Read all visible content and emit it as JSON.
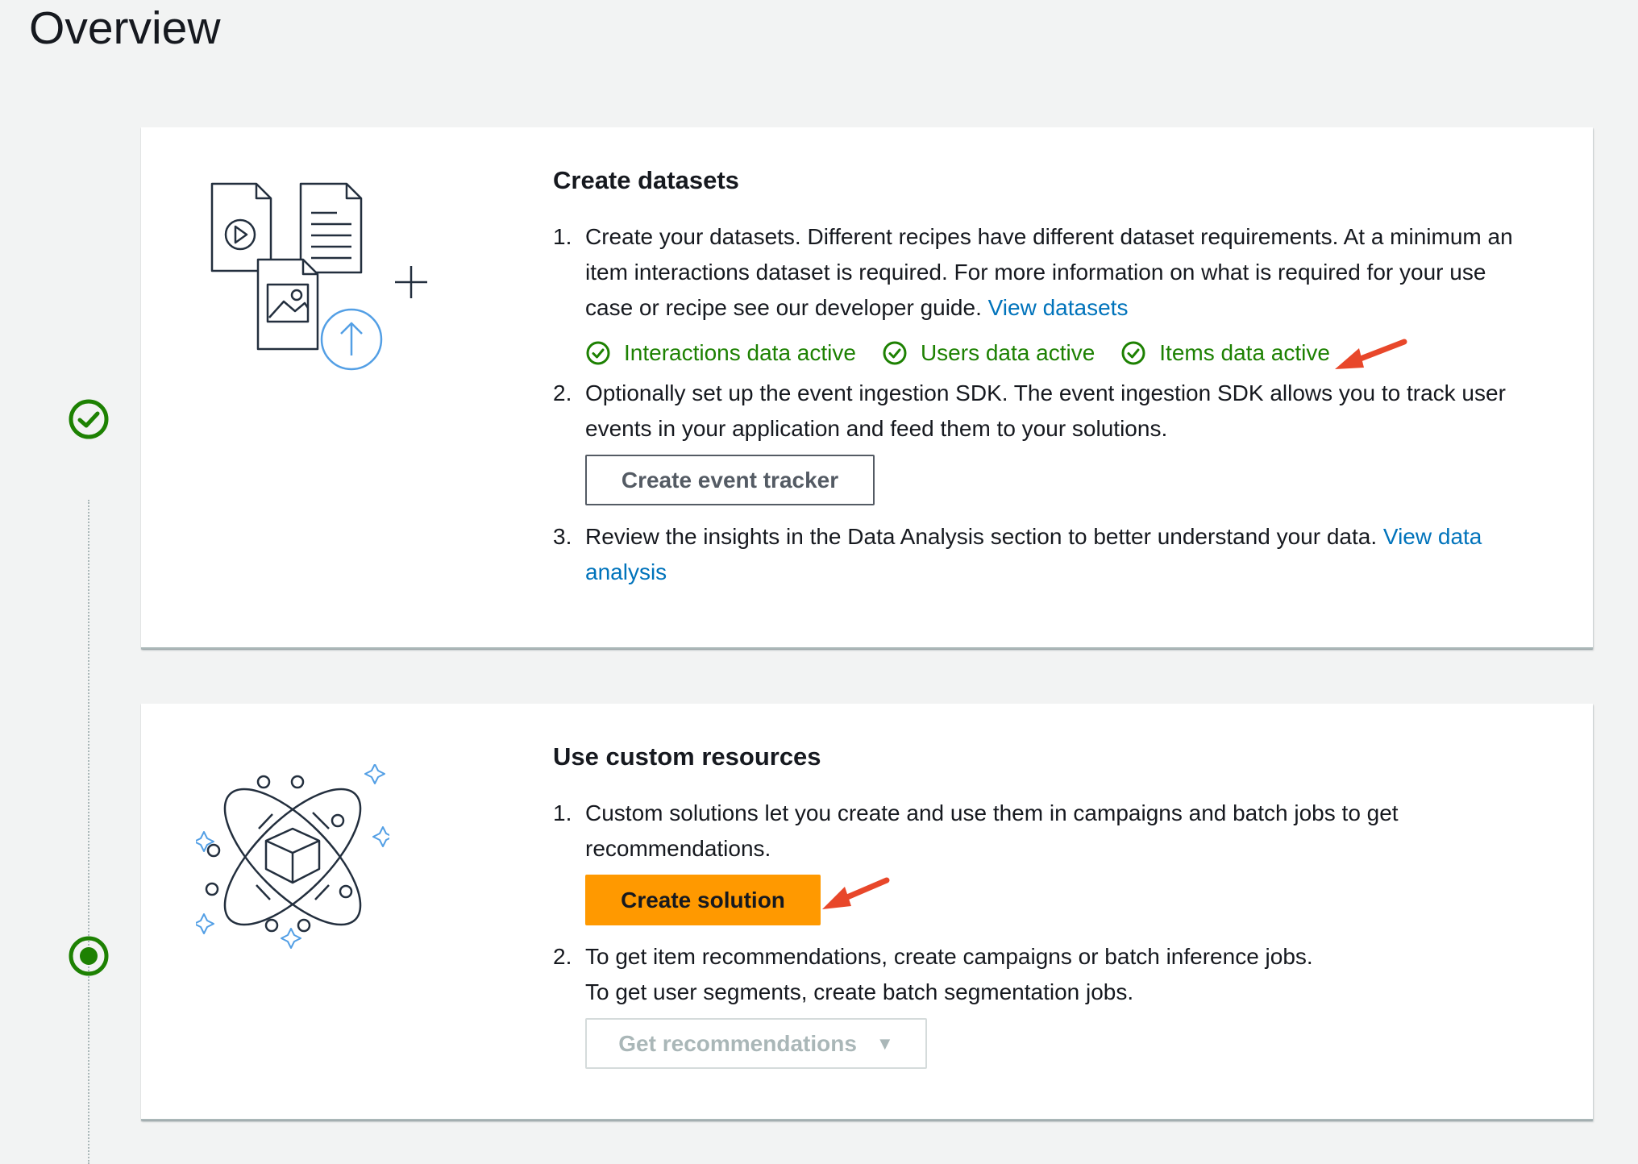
{
  "page": {
    "title": "Overview"
  },
  "colors": {
    "background": "#f2f3f3",
    "success": "#1d8102",
    "link": "#0073bb",
    "primary_button": "#ff9900",
    "annotation_arrow": "#e8472a",
    "illustration_accent": "#539fe5"
  },
  "steps": [
    {
      "status": "complete",
      "icon": "check-circle-icon",
      "title": "Create datasets",
      "illustration": "dataset-files-upload-illustration",
      "items": [
        {
          "number": "1.",
          "text": "Create your datasets. Different recipes have different dataset requirements. At a minimum an item interactions dataset is required. For more information on what is required for your use case or recipe see our developer guide.",
          "link": "View datasets",
          "statuses": [
            {
              "label": "Interactions data active",
              "icon": "check-circle-icon"
            },
            {
              "label": "Users data active",
              "icon": "check-circle-icon"
            },
            {
              "label": "Items data active",
              "icon": "check-circle-icon"
            }
          ]
        },
        {
          "number": "2.",
          "text": "Optionally set up the event ingestion SDK. The event ingestion SDK allows you to track user events in your application and feed them to your solutions.",
          "button": "Create event tracker"
        },
        {
          "number": "3.",
          "text": "Review the insights in the Data Analysis section to better understand your data.",
          "link": "View data analysis"
        }
      ]
    },
    {
      "status": "in-progress",
      "icon": "radio-dot-icon",
      "title": "Use custom resources",
      "illustration": "orbit-cube-illustration",
      "items": [
        {
          "number": "1.",
          "text": "Custom solutions let you create and use them in campaigns and batch jobs to get recommendations.",
          "button": "Create solution"
        },
        {
          "number": "2.",
          "text": "To get item recommendations, create campaigns or batch inference jobs.",
          "text2": "To get user segments, create batch segmentation jobs.",
          "button": "Get recommendations",
          "button_disabled": true,
          "button_icon": "caret-down-icon"
        }
      ]
    }
  ]
}
